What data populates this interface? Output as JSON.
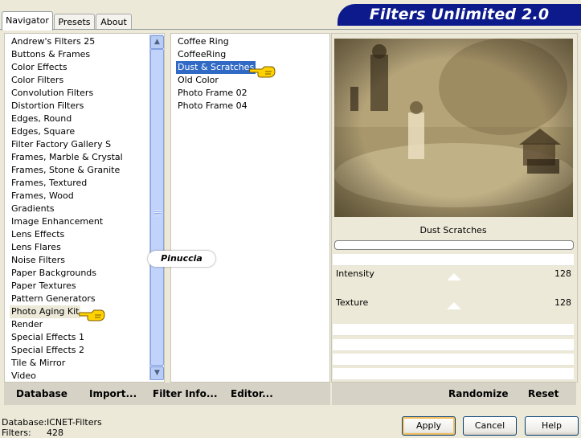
{
  "tabs": [
    {
      "label": "Navigator",
      "active": true
    },
    {
      "label": "Presets",
      "active": false
    },
    {
      "label": "About",
      "active": false
    }
  ],
  "banner": {
    "title": "Filters Unlimited 2.0"
  },
  "categories": [
    "Andrew's Filters 25",
    "Buttons & Frames",
    "Color Effects",
    "Color Filters",
    "Convolution Filters",
    "Distortion Filters",
    "Edges, Round",
    "Edges, Square",
    "Filter Factory Gallery S",
    "Frames, Marble & Crystal",
    "Frames, Stone & Granite",
    "Frames, Textured",
    "Frames, Wood",
    "Gradients",
    "Image Enhancement",
    "Lens Effects",
    "Lens Flares",
    "Noise Filters",
    "Paper Backgrounds",
    "Paper Textures",
    "Pattern Generators",
    "Photo Aging Kit",
    "Render",
    "Special Effects 1",
    "Special Effects 2",
    "Tile & Mirror",
    "Video"
  ],
  "selected_category": "Photo Aging Kit",
  "filters": [
    "Coffee Ring",
    "CoffeeRing",
    "Dust & Scratches",
    "Old Color",
    "Photo Frame 02",
    "Photo Frame 04"
  ],
  "selected_filter": "Dust & Scratches",
  "watermark": "Pinuccia",
  "filter_title": "Dust  Scratches",
  "sliders": [
    {
      "label": "Intensity",
      "value": "128"
    },
    {
      "label": "Texture",
      "value": "128"
    }
  ],
  "left_toolbar": {
    "database": "Database",
    "import": "Import...",
    "filter_info": "Filter Info...",
    "editor": "Editor..."
  },
  "right_toolbar": {
    "randomize": "Randomize",
    "reset": "Reset"
  },
  "status": {
    "database_label": "Database:",
    "database_value": "ICNET-Filters",
    "filters_label": "Filters:",
    "filters_value": "428"
  },
  "buttons": {
    "apply": "Apply",
    "cancel": "Cancel",
    "help": "Help"
  },
  "colors": {
    "banner": "#0c1a8c",
    "selection": "#316ac5",
    "background": "#ece9d8"
  }
}
